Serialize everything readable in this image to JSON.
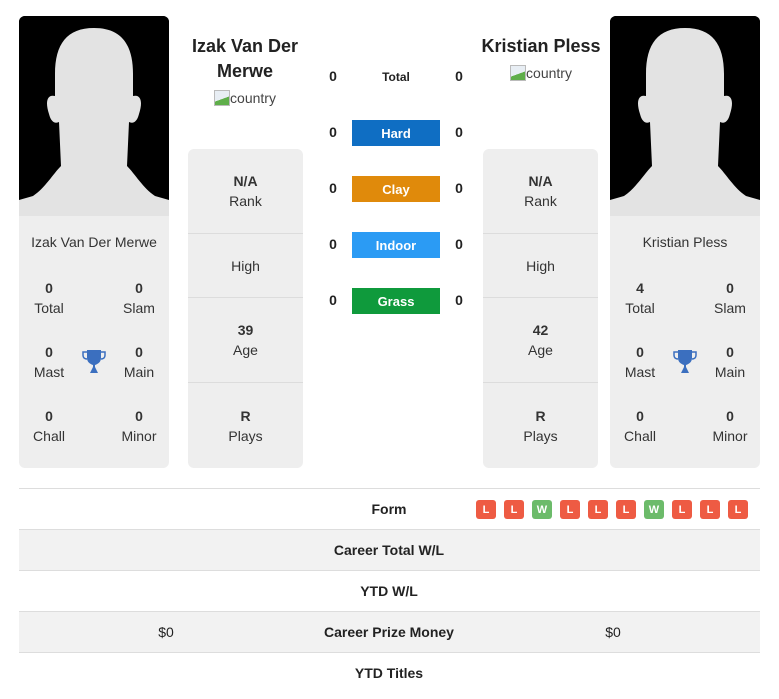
{
  "colors": {
    "hard": "#0f6ec3",
    "clay": "#e08a0b",
    "indoor": "#2b9bf4",
    "grass": "#0f9a3c",
    "loss": "#ee5b43",
    "win": "#6cbb6a",
    "trophy": "#3b6fbf"
  },
  "players": [
    {
      "name": "Izak Van Der Merwe",
      "card_name": "Izak Van Der Merwe",
      "country_alt": "country",
      "rank": "N/A",
      "rank_label": "Rank",
      "high_label": "High",
      "age": "39",
      "age_label": "Age",
      "plays": "R",
      "plays_label": "Plays",
      "titles": {
        "total": "0",
        "total_label": "Total",
        "slam": "0",
        "slam_label": "Slam",
        "mast": "0",
        "mast_label": "Mast",
        "main": "0",
        "main_label": "Main",
        "chall": "0",
        "chall_label": "Chall",
        "minor": "0",
        "minor_label": "Minor"
      }
    },
    {
      "name": "Kristian Pless",
      "card_name": "Kristian Pless",
      "country_alt": "country",
      "rank": "N/A",
      "rank_label": "Rank",
      "high_label": "High",
      "age": "42",
      "age_label": "Age",
      "plays": "R",
      "plays_label": "Plays",
      "titles": {
        "total": "4",
        "total_label": "Total",
        "slam": "0",
        "slam_label": "Slam",
        "mast": "0",
        "mast_label": "Mast",
        "main": "0",
        "main_label": "Main",
        "chall": "0",
        "chall_label": "Chall",
        "minor": "0",
        "minor_label": "Minor"
      }
    }
  ],
  "h2h": {
    "total": {
      "label": "Total",
      "left": "0",
      "right": "0"
    },
    "surfaces": [
      {
        "label": "Hard",
        "left": "0",
        "right": "0",
        "icon": "hard-court"
      },
      {
        "label": "Clay",
        "left": "0",
        "right": "0",
        "icon": "clay-court"
      },
      {
        "label": "Indoor",
        "left": "0",
        "right": "0",
        "icon": "indoor-court"
      },
      {
        "label": "Grass",
        "left": "0",
        "right": "0",
        "icon": "grass-court"
      }
    ]
  },
  "stats": {
    "form_label": "Form",
    "form": [
      "L",
      "L",
      "W",
      "L",
      "L",
      "L",
      "W",
      "L",
      "L",
      "L"
    ],
    "rows": [
      {
        "label": "Career Total W/L",
        "left": "",
        "right": ""
      },
      {
        "label": "YTD W/L",
        "left": "",
        "right": ""
      },
      {
        "label": "Career Prize Money",
        "left": "$0",
        "right": "$0"
      },
      {
        "label": "YTD Titles",
        "left": "",
        "right": ""
      }
    ]
  }
}
